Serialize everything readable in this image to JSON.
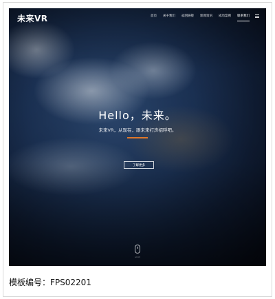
{
  "site": {
    "logo": "未来VR",
    "nav": [
      {
        "label": "首页",
        "active": false
      },
      {
        "label": "关于我们",
        "active": false
      },
      {
        "label": "返回链接",
        "active": false
      },
      {
        "label": "新闻资讯",
        "active": false
      },
      {
        "label": "成功案例",
        "active": false
      },
      {
        "label": "联系我们",
        "active": true
      }
    ]
  },
  "hero": {
    "title": "Hello，未来。",
    "subtitle": "未来VR，从现在，跟未来打声招呼吧。",
    "button_label": "了解更多",
    "scroll_label": "scroll",
    "accent_color": "#e0782a"
  },
  "caption": "模板编号：FPS02201"
}
